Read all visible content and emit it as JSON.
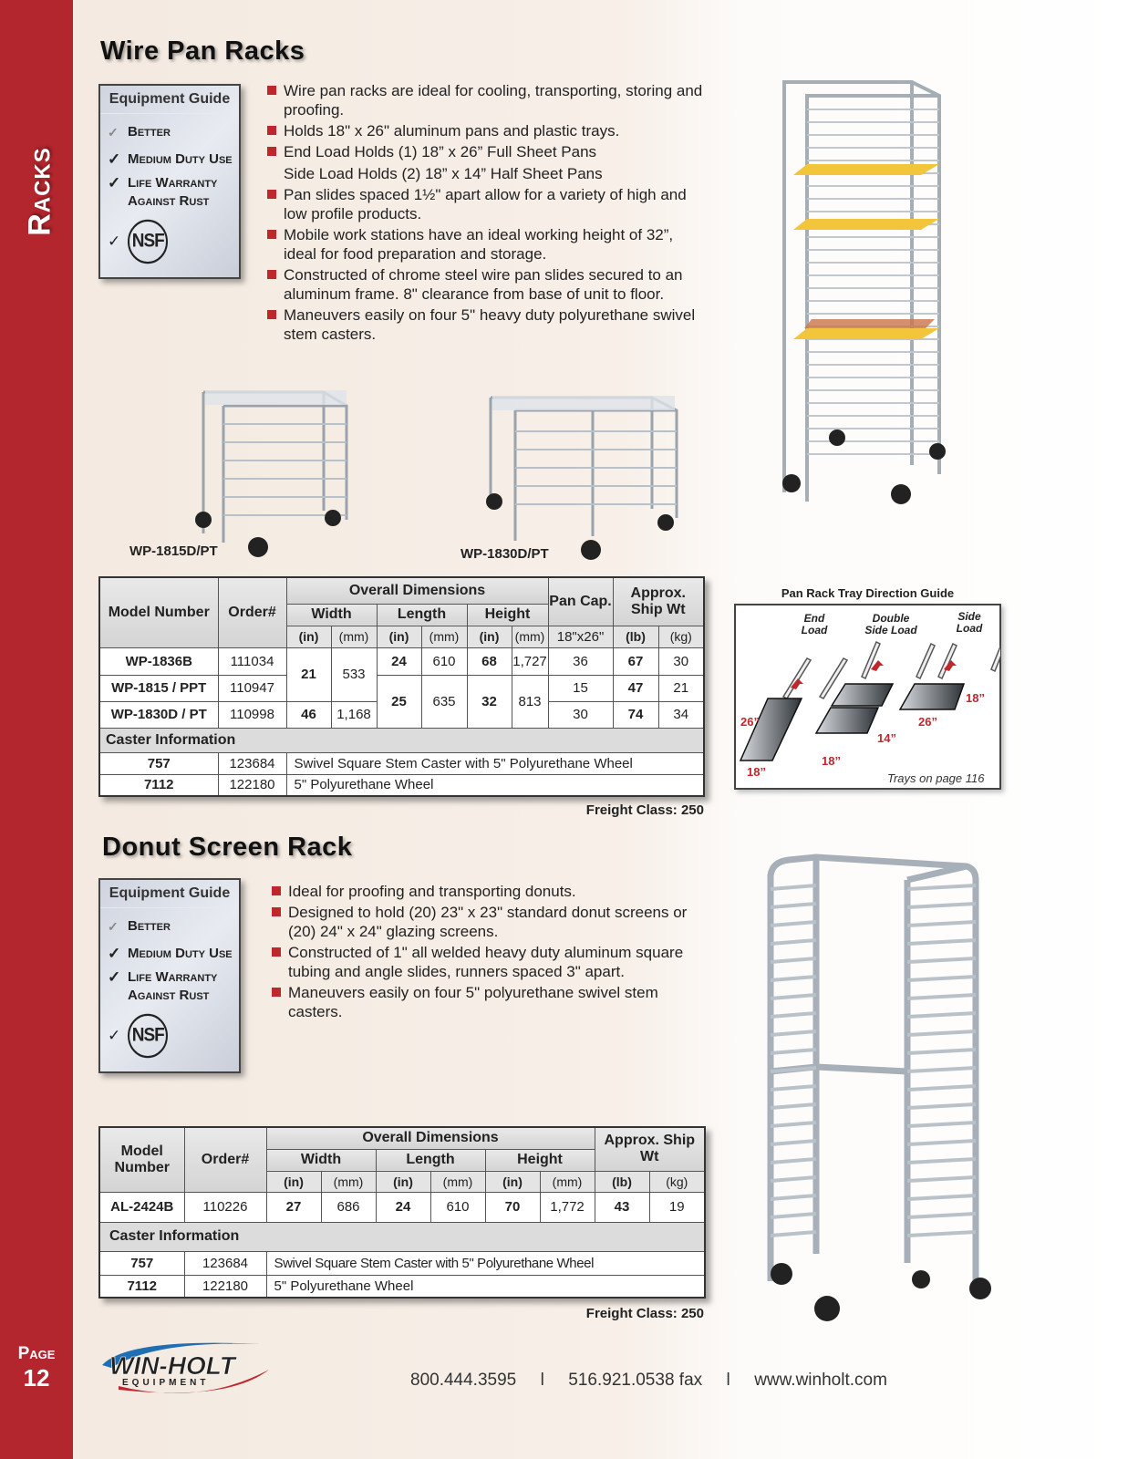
{
  "sidebar": {
    "section": "Racks",
    "page_word": "Page",
    "page_number": "12"
  },
  "wire": {
    "title": "Wire Pan Racks",
    "guide": {
      "title": "Equipment Guide",
      "items": [
        "Better",
        "Medium Duty Use",
        "Life Warranty",
        "Against Rust"
      ],
      "nsf": "NSF"
    },
    "bullets": [
      "Wire pan racks are ideal for cooling, transporting, storing and proofing.",
      "Holds 18\" x 26\" aluminum pans and plastic trays.",
      "End Load Holds (1) 18” x 26” Full Sheet Pans",
      "Pan slides spaced 1½\" apart allow for a variety of high and low profile products.",
      "Mobile work stations have an ideal working height of 32”, ideal for food preparation and storage.",
      "Constructed of chrome steel wire pan slides secured to an aluminum frame. 8\" clearance from base of unit to floor.",
      "Maneuvers easily on four 5\" heavy duty polyurethane swivel stem casters."
    ],
    "bullet_continuation": "Side Load Holds (2) 18” x 14” Half Sheet Pans",
    "product_labels": [
      "WP-1815D/PT",
      "WP-1830D/PT"
    ],
    "table": {
      "headers": {
        "model": "Model Number",
        "order": "Order#",
        "overall": "Overall Dimensions",
        "width": "Width",
        "length": "Length",
        "height": "Height",
        "pan": "Pan Cap.",
        "ship": "Approx. Ship Wt",
        "in": "(in)",
        "mm": "(mm)",
        "pan_size": "18\"x26\"",
        "lb": "(lb)",
        "kg": "(kg)"
      },
      "rows": [
        {
          "model": "WP-1836B",
          "order": "111034",
          "w_in": "21",
          "w_mm": "533",
          "l_in": "24",
          "l_mm": "610",
          "h_in": "68",
          "h_mm": "1,727",
          "pan": "36",
          "lb": "67",
          "kg": "30"
        },
        {
          "model": "WP-1815 / PPT",
          "order": "110947",
          "l_in": "25",
          "l_mm": "635",
          "h_in": "32",
          "h_mm": "813",
          "pan": "15",
          "lb": "47",
          "kg": "21"
        },
        {
          "model": "WP-1830D / PT",
          "order": "110998",
          "w_in": "46",
          "w_mm": "1,168",
          "pan": "30",
          "lb": "74",
          "kg": "34"
        }
      ],
      "caster_header": "Caster Information",
      "casters": [
        {
          "model": "757",
          "order": "123684",
          "desc": "Swivel Square Stem Caster with 5\" Polyurethane Wheel"
        },
        {
          "model": "7112",
          "order": "122180",
          "desc": "5\" Polyurethane Wheel"
        }
      ]
    },
    "freight": "Freight Class: 250"
  },
  "tray_guide": {
    "title": "Pan Rack Tray Direction Guide",
    "labels": [
      "End Load",
      "Double Side Load",
      "Side Load"
    ],
    "dims": [
      "26”",
      "18”",
      "18”",
      "14”",
      "26”",
      "18”"
    ],
    "note": "Trays on page 116",
    "accent": "#c0272d"
  },
  "donut": {
    "title": "Donut Screen Rack",
    "guide": {
      "title": "Equipment Guide",
      "items": [
        "Better",
        "Medium Duty Use",
        "Life Warranty",
        "Against Rust"
      ],
      "nsf": "NSF"
    },
    "bullets": [
      "Ideal for proofing and transporting donuts.",
      "Designed to hold (20) 23\" x 23\" standard donut screens or  (20) 24\" x 24\" glazing screens.",
      "Constructed of 1\" all welded heavy duty aluminum square tubing and angle slides, runners spaced 3\" apart.",
      "Maneuvers easily on four 5\" polyurethane swivel stem casters."
    ],
    "table": {
      "headers": {
        "model": "Model Number",
        "order": "Order#",
        "overall": "Overall Dimensions",
        "width": "Width",
        "length": "Length",
        "height": "Height",
        "ship": "Approx. Ship Wt",
        "in": "(in)",
        "mm": "(mm)",
        "lb": "(lb)",
        "kg": "(kg)"
      },
      "row": {
        "model": "AL-2424B",
        "order": "110226",
        "w_in": "27",
        "w_mm": "686",
        "l_in": "24",
        "l_mm": "610",
        "h_in": "70",
        "h_mm": "1,772",
        "lb": "43",
        "kg": "19"
      },
      "caster_header": "Caster Information",
      "casters": [
        {
          "model": "757",
          "order": "123684",
          "desc": "Swivel Square Stem Caster with 5\" Polyurethane Wheel"
        },
        {
          "model": "7112",
          "order": "122180",
          "desc": "5\" Polyurethane Wheel"
        }
      ]
    },
    "freight": "Freight Class: 250"
  },
  "footer": {
    "logo": "WIN-HOLT EQUIPMENT",
    "phone": "800.444.3595",
    "fax": "516.921.0538 fax",
    "separator": "l",
    "website": "www.winholt.com"
  },
  "colors": {
    "sidebar": "#b3262e",
    "bullet": "#c0272d",
    "logo_blue": "#1f6fb5"
  }
}
